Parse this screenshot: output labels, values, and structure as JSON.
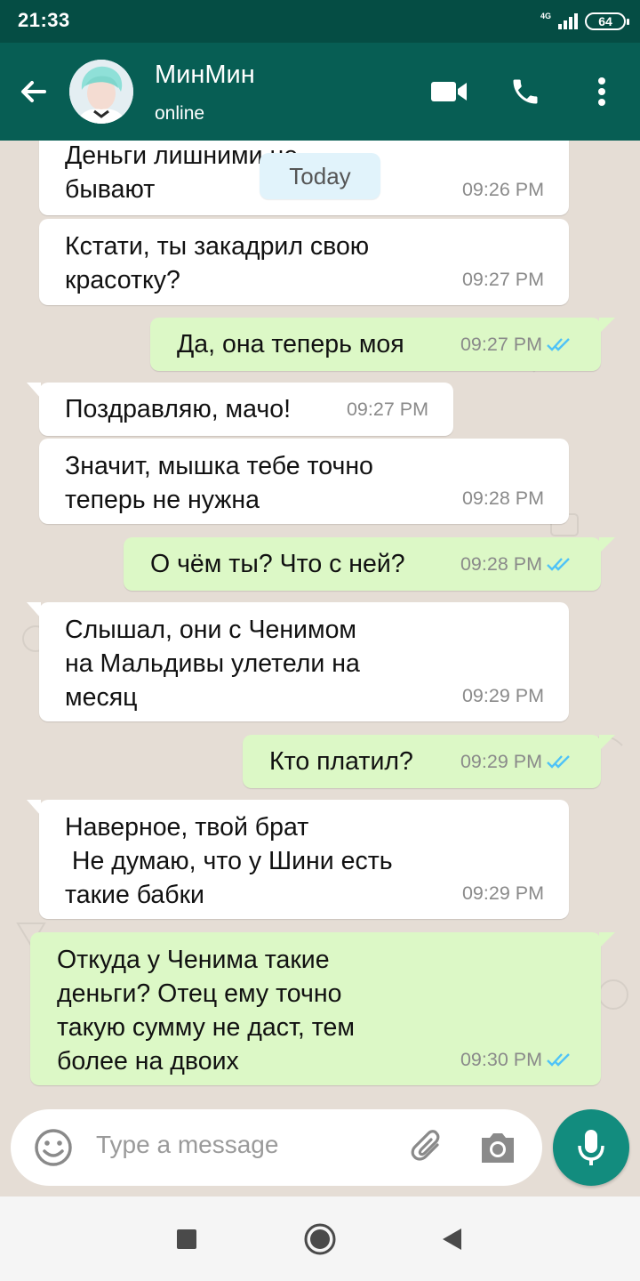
{
  "status_bar": {
    "time": "21:33",
    "network": "4G",
    "battery": "64"
  },
  "header": {
    "contact_name": "МинМин",
    "status": "online"
  },
  "date_chip": "Today",
  "messages": [
    {
      "dir": "in",
      "text": "Деньги лишними не\nбывают",
      "time": "09:26 PM"
    },
    {
      "dir": "in",
      "text": "Кстати, ты закадрил свою\nкрасотку?",
      "time": "09:27 PM"
    },
    {
      "dir": "out",
      "text": "Да, она теперь моя",
      "time": "09:27 PM",
      "read": true
    },
    {
      "dir": "in",
      "text": "Поздравляю, мачо!",
      "time": "09:27 PM"
    },
    {
      "dir": "in",
      "text": "Значит, мышка тебе точно\nтеперь не нужна",
      "time": "09:28 PM"
    },
    {
      "dir": "out",
      "text": "О чём ты? Что с ней?",
      "time": "09:28 PM",
      "read": true
    },
    {
      "dir": "in",
      "text": "Слышал, они с Ченимом\nна Мальдивы улетели на\nмесяц",
      "time": "09:29 PM"
    },
    {
      "dir": "out",
      "text": "Кто платил?",
      "time": "09:29 PM",
      "read": true
    },
    {
      "dir": "in",
      "text": "Наверное, твой брат\n Не думаю, что у Шини есть\nтакие бабки",
      "time": "09:29 PM"
    },
    {
      "dir": "out",
      "text": "Откуда у Ченима такие\nденьги? Отец ему точно\nтакую сумму не даст, тем\nболее на двоих",
      "time": "09:30 PM",
      "read": true
    }
  ],
  "composer": {
    "placeholder": "Type a message"
  },
  "colors": {
    "header": "#075e54",
    "status_bar": "#054d44",
    "outgoing": "#dcf8c6",
    "incoming": "#ffffff",
    "read_ticks": "#4fc3f7",
    "mic": "#128c7e"
  }
}
